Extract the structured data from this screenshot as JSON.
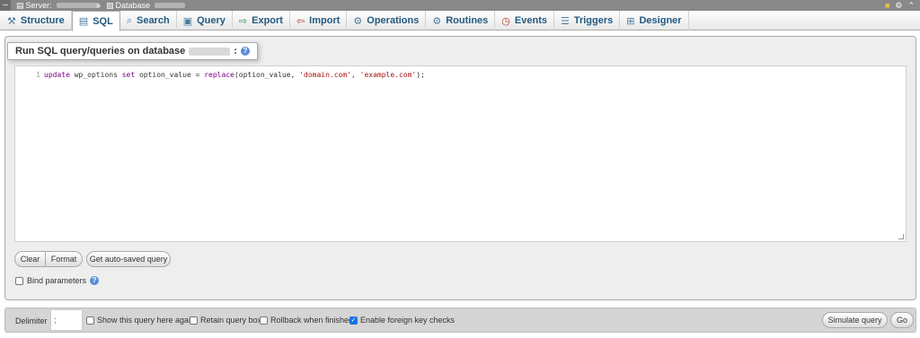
{
  "topbar": {
    "collapse_glyph": "–",
    "server_label": "Server:",
    "separator": "»",
    "database_label": "Database"
  },
  "tabs": [
    {
      "label": "Structure",
      "icon": "structure-icon",
      "glyph": "⚒"
    },
    {
      "label": "SQL",
      "icon": "sql-icon",
      "glyph": "▤",
      "active": true
    },
    {
      "label": "Search",
      "icon": "search-icon",
      "glyph": "⌕"
    },
    {
      "label": "Query",
      "icon": "query-icon",
      "glyph": "▣"
    },
    {
      "label": "Export",
      "icon": "export-icon",
      "glyph": "⇨"
    },
    {
      "label": "Import",
      "icon": "import-icon",
      "glyph": "⇦"
    },
    {
      "label": "Operations",
      "icon": "operations-icon",
      "glyph": "⚙"
    },
    {
      "label": "Routines",
      "icon": "routines-icon",
      "glyph": "⚙"
    },
    {
      "label": "Events",
      "icon": "events-icon",
      "glyph": "◷"
    },
    {
      "label": "Triggers",
      "icon": "triggers-icon",
      "glyph": "☰"
    },
    {
      "label": "Designer",
      "icon": "designer-icon",
      "glyph": "⊞"
    }
  ],
  "sql_box": {
    "legend": "Run SQL query/queries on database",
    "legend_suffix": ":",
    "line_number": "1",
    "query": {
      "t1": "update",
      "t2": " wp_options ",
      "t3": "set",
      "t4": " option_value = ",
      "t5": "replace",
      "t6": "(option_value, ",
      "t7": "'domain.com'",
      "t8": ", ",
      "t9": "'example.com'",
      "t10": ");"
    }
  },
  "buttons": {
    "clear": "Clear",
    "format": "Format",
    "autosave": "Get auto-saved query",
    "simulate": "Simulate query",
    "go": "Go"
  },
  "bind_parameters": {
    "label": "Bind parameters",
    "checked": false
  },
  "bottom": {
    "delimiter_label": "Delimiter",
    "delimiter_value": ";",
    "options": [
      {
        "label": "Show this query here again",
        "checked": false
      },
      {
        "label": "Retain query box",
        "checked": false
      },
      {
        "label": "Rollback when finished",
        "checked": false
      },
      {
        "label": "Enable foreign key checks",
        "checked": true
      }
    ]
  },
  "colors": {
    "tab_text": "#235a81",
    "checkbox_checked": "#1a73e8"
  }
}
